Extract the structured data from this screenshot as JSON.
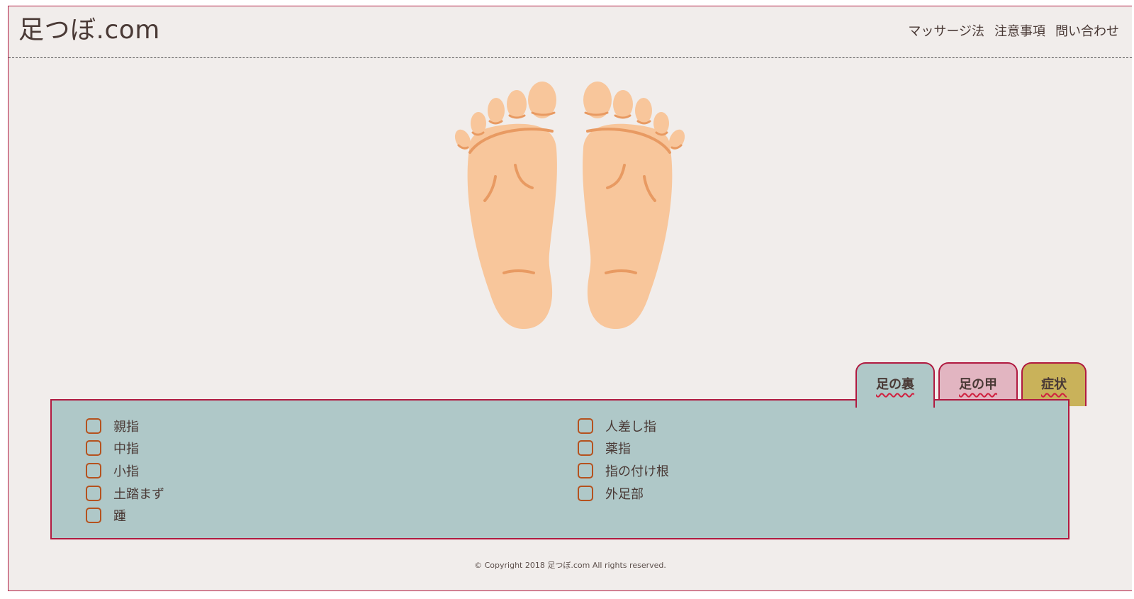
{
  "site": {
    "title": "足つぼ.com"
  },
  "nav": {
    "items": [
      "マッサージ法",
      "注意事項",
      "問い合わせ"
    ]
  },
  "illustration": {
    "name": "feet-soles-illustration"
  },
  "tabs": [
    {
      "label": "足の裏",
      "color": "#afc8c8",
      "active": true
    },
    {
      "label": "足の甲",
      "color": "#e2b5c1",
      "active": false
    },
    {
      "label": "症状",
      "color": "#c9b25a",
      "active": false
    }
  ],
  "options": {
    "left": [
      "親指",
      "中指",
      "小指",
      "土踏まず",
      "踵"
    ],
    "right": [
      "人差し指",
      "薬指",
      "指の付け根",
      "外足部"
    ]
  },
  "footer": {
    "copyright": "© Copyright 2018 足つぼ.com All rights reserved."
  },
  "colors": {
    "border": "#b01a40",
    "background": "#f1edeb",
    "checkbox": "#b5521e"
  }
}
